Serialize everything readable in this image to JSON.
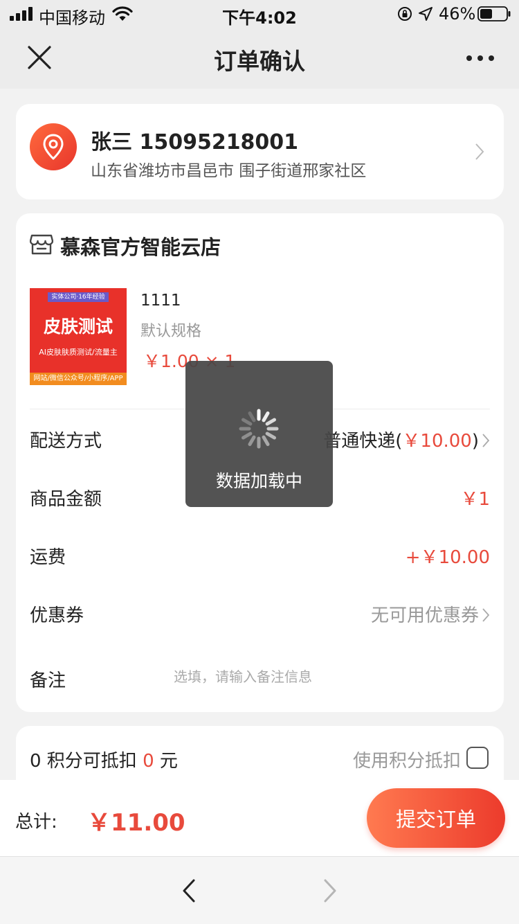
{
  "status_bar": {
    "carrier": "中国移动",
    "time": "下午4:02",
    "battery": "46%",
    "icons": [
      "signal-icon",
      "wifi-icon",
      "orientation-lock-icon",
      "location-icon",
      "battery-icon"
    ]
  },
  "nav": {
    "title": "订单确认",
    "icons": [
      "close-icon",
      "more-icon"
    ]
  },
  "address": {
    "name_phone": "张三 15095218001",
    "detail": "山东省潍坊市昌邑市 围子街道邢家社区",
    "icons": [
      "location-pin-icon",
      "chevron-right-icon"
    ]
  },
  "shop": {
    "name": "慕森官方智能云店",
    "icon": "store-icon"
  },
  "product": {
    "image": {
      "tag": "实体公司·16年经验",
      "title": "皮肤测试",
      "subtitle": "AI皮肤肤质测试/流量主",
      "footer": "网站/微信公众号/小程序/APP"
    },
    "name": "1111",
    "spec": "默认规格",
    "price": "￥1.00 × 1"
  },
  "rows": {
    "delivery": {
      "label": "配送方式",
      "method": "普通快递(",
      "price": "￥10.00",
      "close": ")"
    },
    "goods_amount": {
      "label": "商品金额",
      "value": "￥1"
    },
    "shipping": {
      "label": "运费",
      "value": "+￥10.00"
    },
    "coupon": {
      "label": "优惠券",
      "value": "无可用优惠券"
    },
    "remark": {
      "label": "备注",
      "placeholder": "选填，请输入备注信息"
    }
  },
  "points": {
    "count": "0",
    "text_mid": " 积分可抵扣 ",
    "amount": "0",
    "text_end": " 元",
    "use_label": "使用积分抵扣",
    "checked": false
  },
  "footer": {
    "total_label": "总计:",
    "total_value": "￥11.00",
    "submit_label": "提交订单"
  },
  "loading": {
    "text": "数据加载中",
    "icon": "spinner-icon"
  },
  "browser": {
    "icons": [
      "back-icon",
      "forward-icon"
    ]
  },
  "colors": {
    "accent": "#e84a3c",
    "button_gradient_start": "#ff7a50",
    "button_gradient_end": "#ec3b2c",
    "page_bg": "#f2f2f2"
  }
}
